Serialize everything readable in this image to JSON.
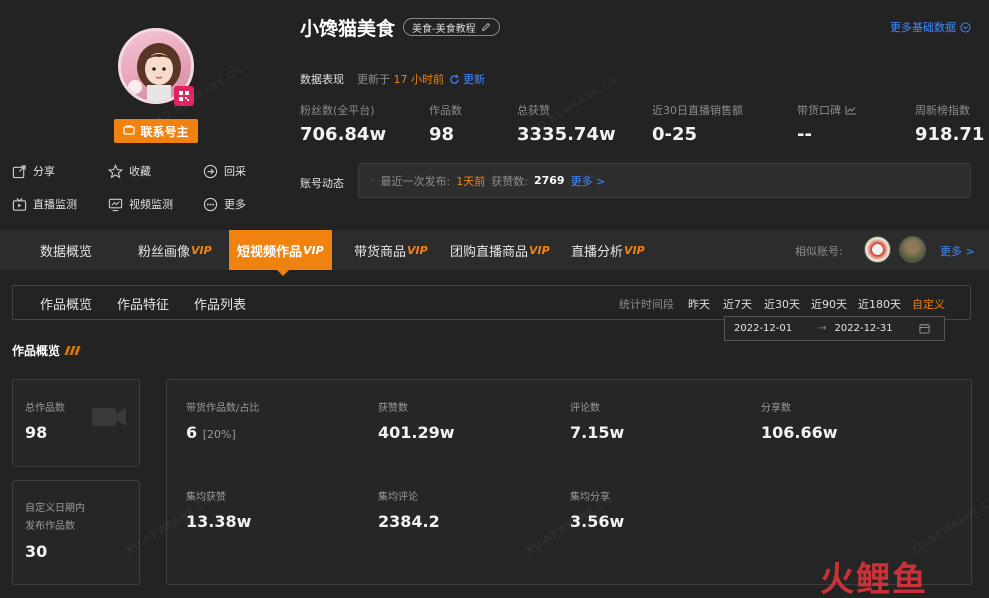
{
  "profile": {
    "name": "小馋猫美食",
    "category_tag": "美食-美食教程",
    "contact_button": "联系号主",
    "actions": {
      "share": "分享",
      "favorite": "收藏",
      "collect": "回采",
      "live_monitor": "直播监测",
      "video_monitor": "视频监测",
      "more": "更多"
    }
  },
  "header": {
    "more_basic_data": "更多基础数据",
    "performance_label": "数据表现",
    "updated_prefix": "更新于",
    "updated_time": "17 小时前",
    "refresh_label": "更新"
  },
  "stats": [
    {
      "label": "粉丝数(全平台)",
      "value": "706.84w"
    },
    {
      "label": "作品数",
      "value": "98"
    },
    {
      "label": "总获赞",
      "value": "3335.74w"
    },
    {
      "label": "近30日直播销售额",
      "value": "0-25"
    },
    {
      "label": "带货口碑",
      "value": "--"
    },
    {
      "label": "周新榜指数",
      "value": "918.71"
    }
  ],
  "dynamics": {
    "label": "账号动态",
    "last_publish_label": "最近一次发布:",
    "last_publish_value": "1天前",
    "likes_label": "获赞数:",
    "likes_value": "2769",
    "more": "更多 >"
  },
  "nav": {
    "items": [
      {
        "label": "数据概览",
        "vip": ""
      },
      {
        "label": "粉丝画像",
        "vip": "VIP"
      },
      {
        "label": "短视频作品",
        "vip": "VIP"
      },
      {
        "label": "带货商品",
        "vip": "VIP"
      },
      {
        "label": "团购直播商品",
        "vip": "VIP"
      },
      {
        "label": "直播分析",
        "vip": "VIP"
      }
    ],
    "active_index": 2,
    "similar_label": "相似账号:",
    "more_similar": "更多 >"
  },
  "subtabs": [
    "作品概览",
    "作品特征",
    "作品列表"
  ],
  "period": {
    "label": "统计时间段",
    "options": [
      "昨天",
      "近7天",
      "近30天",
      "近90天",
      "近180天",
      "自定义"
    ],
    "selected": "自定义",
    "date_start": "2022-12-01",
    "date_sep": "→",
    "date_end": "2022-12-31"
  },
  "overview": {
    "title": "作品概览",
    "total_works_label": "总作品数",
    "total_works_value": "98",
    "custom_period_label_line1": "自定义日期内",
    "custom_period_label_line2": "发布作品数",
    "custom_period_value": "30",
    "metrics": [
      {
        "label": "带货作品数/占比",
        "value": "6",
        "extra": "[20%]"
      },
      {
        "label": "获赞数",
        "value": "401.29w",
        "extra": ""
      },
      {
        "label": "评论数",
        "value": "7.15w",
        "extra": ""
      },
      {
        "label": "分享数",
        "value": "106.66w",
        "extra": ""
      },
      {
        "label": "集均获赞",
        "value": "13.38w",
        "extra": ""
      },
      {
        "label": "集均评论",
        "value": "2384.2",
        "extra": ""
      },
      {
        "label": "集均分享",
        "value": "3.56w",
        "extra": ""
      }
    ]
  },
  "watermark_text": "XD.NEWRANK.CN",
  "brand_logo_text": "火鲤鱼",
  "colors": {
    "accent": "#f0820f",
    "link": "#3e8bff",
    "background": "#232323"
  }
}
